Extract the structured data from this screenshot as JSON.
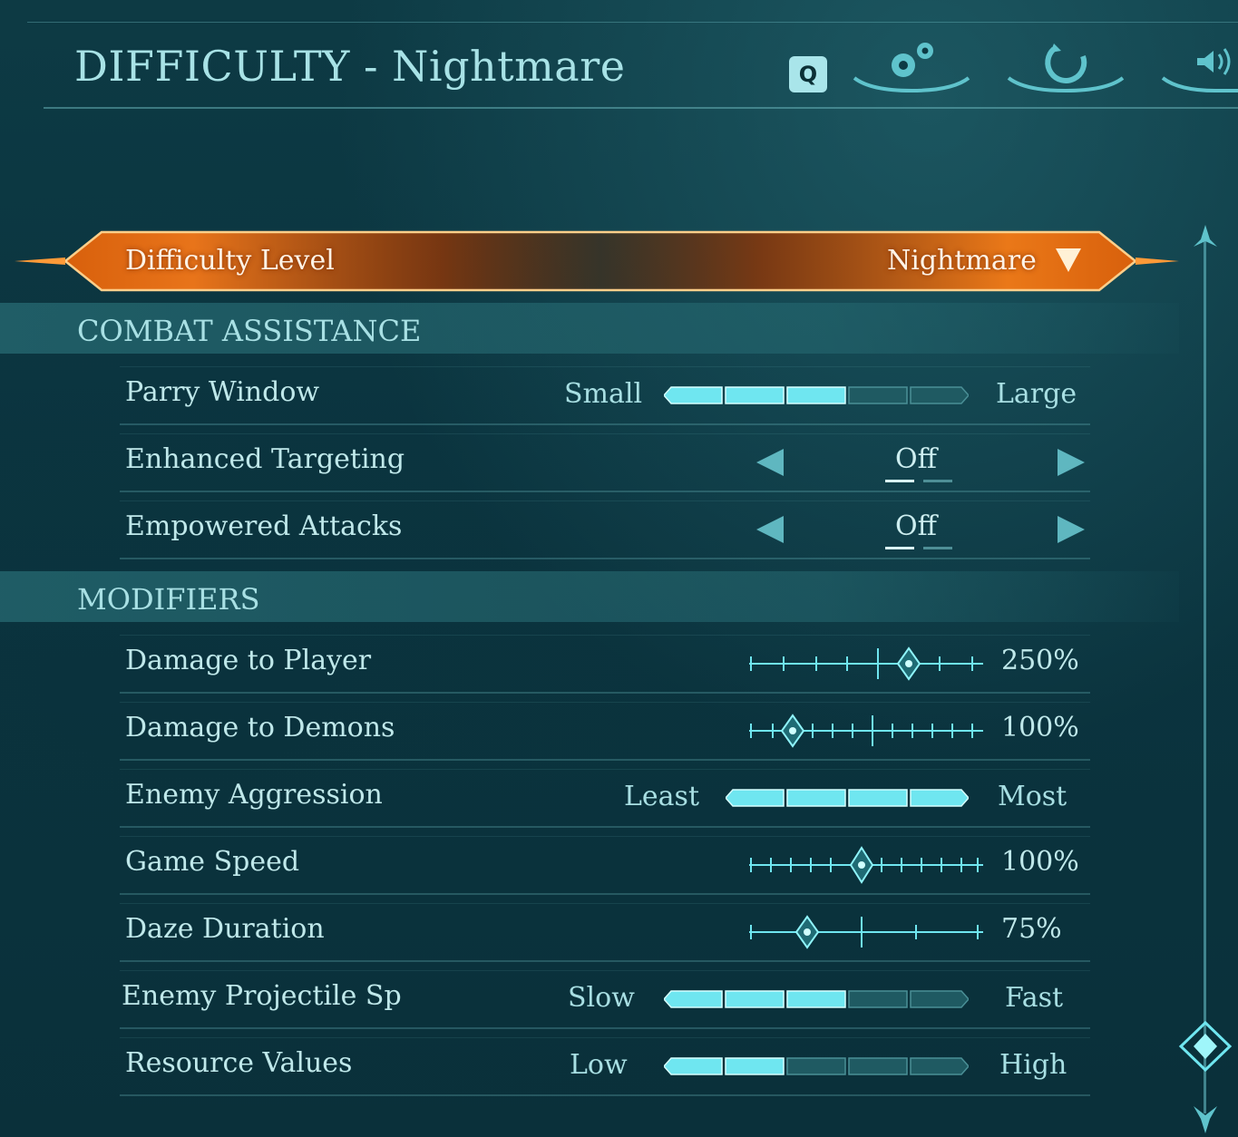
{
  "header": {
    "title": "DIFFICULTY - Nightmare",
    "key_hint": "Q",
    "tabs": [
      {
        "icon": "gears-icon"
      },
      {
        "icon": "controller-icon"
      },
      {
        "icon": "speaker-icon"
      }
    ]
  },
  "difficulty": {
    "label": "Difficulty Level",
    "value": "Nightmare"
  },
  "sections": {
    "combat": "COMBAT ASSISTANCE",
    "modifiers": "MODIFIERS"
  },
  "rows": {
    "parry": {
      "label": "Parry Window",
      "min": "Small",
      "max": "Large",
      "level": 3,
      "segments": 5
    },
    "targeting": {
      "label": "Enhanced Targeting",
      "value": "Off"
    },
    "empowered": {
      "label": "Empowered Attacks",
      "value": "Off"
    },
    "dmg_player": {
      "label": "Damage to Player",
      "value": "250%"
    },
    "dmg_demons": {
      "label": "Damage to Demons",
      "value": "100%"
    },
    "aggression": {
      "label": "Enemy Aggression",
      "min": "Least",
      "max": "Most",
      "level": 4,
      "segments": 4
    },
    "game_speed": {
      "label": "Game Speed",
      "value": "100%"
    },
    "daze": {
      "label": "Daze Duration",
      "value": "75%"
    },
    "projectile": {
      "label": "Enemy Projectile Speed",
      "min": "Slow",
      "max": "Fast",
      "level": 3,
      "segments": 5
    },
    "resource": {
      "label": "Resource Values",
      "min": "Low",
      "max": "High",
      "level": 2,
      "segments": 5
    }
  },
  "colors": {
    "accent": "#6fe6f0",
    "accent_dim": "#1f5a62",
    "orange": "#e06a10"
  }
}
